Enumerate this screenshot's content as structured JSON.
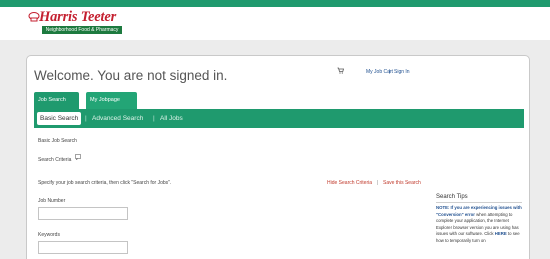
{
  "brand": {
    "name": "Harris Teeter",
    "tagline": "Neighborhood Food & Pharmacy",
    "colors": {
      "brand_red": "#c41f2f",
      "accent_green": "#1f9a6e",
      "tagline_green": "#1d7a3f",
      "link_blue": "#1f4f8f",
      "link_red": "#c0392b"
    }
  },
  "header": {
    "welcome": "Welcome. You are not signed in.",
    "cart_icon": "shopping-cart-icon",
    "my_job_cart": "My Job Cart",
    "separator": "|",
    "sign_in": "Sign In"
  },
  "tabs": [
    {
      "label": "Job Search",
      "active": true
    },
    {
      "label": "My Jobpage",
      "active": false
    }
  ],
  "subnav": {
    "items": [
      "Basic Search",
      "Advanced Search",
      "All Jobs"
    ],
    "separator": "|"
  },
  "main": {
    "section_title": "Basic Job Search",
    "criteria_label": "Search Criteria",
    "info_icon": "info-icon",
    "instructions": "Specify your job search criteria, then click \"Search for Jobs\".",
    "hide_criteria": "Hide Search Criteria",
    "save_search": "Save this Search",
    "link_separator": "|",
    "fields": {
      "job_number": {
        "label": "Job Number",
        "value": ""
      },
      "keywords": {
        "label": "Keywords",
        "value": ""
      }
    }
  },
  "tips": {
    "title": "Search Tips",
    "note_lead": "NOTE: If you are experiencing issues with \"Conversion\" error",
    "body": "when attempting to complete your application, the Internet Explorer browser version you are using has issues with our software. Click",
    "here": "HERE",
    "tail": "to see how to temporarily turn on"
  }
}
